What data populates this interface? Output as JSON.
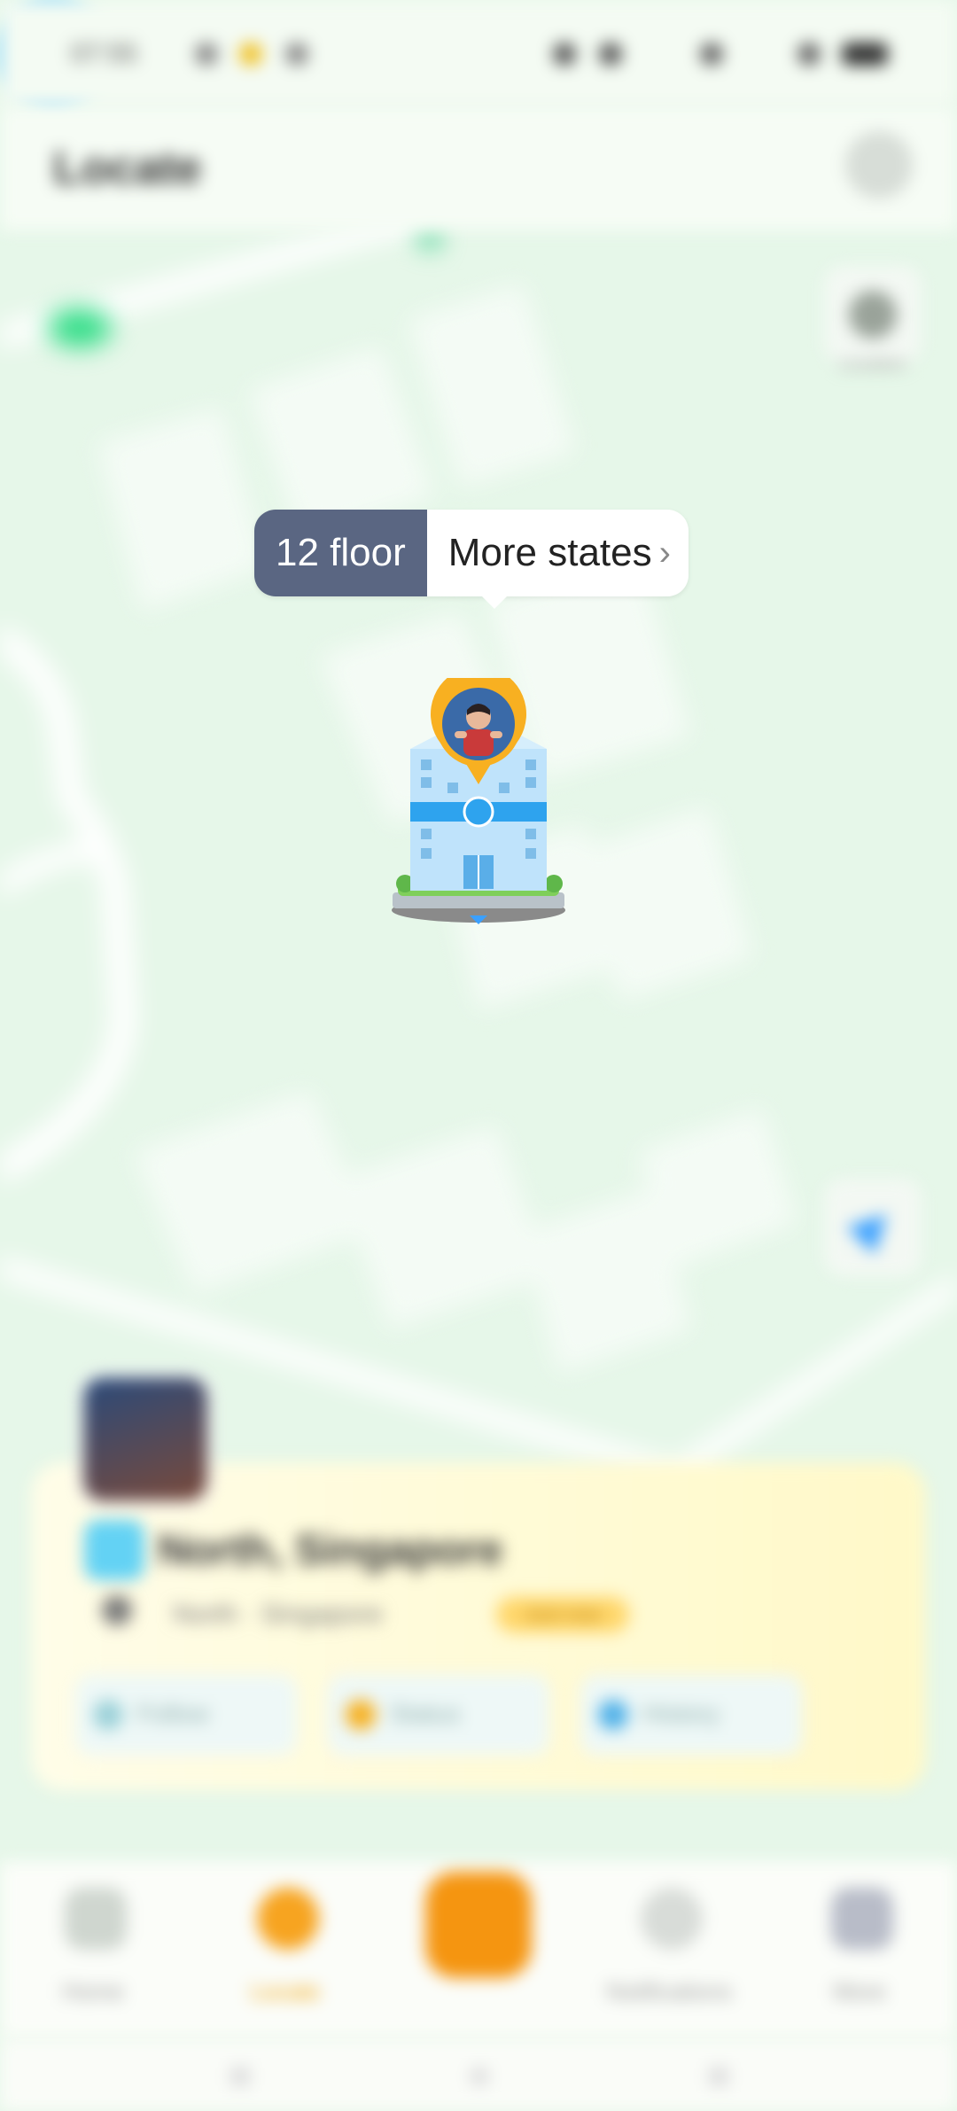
{
  "status_bar": {
    "time": "07:55"
  },
  "header": {
    "title": "Locate"
  },
  "map": {
    "layers_label": "Location",
    "marker": {
      "floor_label": "12 floor",
      "more_label": "More states",
      "chevron": "›"
    }
  },
  "card": {
    "location_title": "North, Singapore",
    "location_sub": "North · Singapore",
    "badge": "Just now",
    "actions": [
      {
        "label": "Follow",
        "icon": "route-icon"
      },
      {
        "label": "Status",
        "icon": "sun-icon"
      },
      {
        "label": "History",
        "icon": "flag-icon"
      }
    ]
  },
  "bottom_nav": {
    "items": [
      {
        "label": "Home",
        "icon": "home-icon"
      },
      {
        "label": "Locate",
        "icon": "locate-icon"
      },
      {
        "label": "",
        "icon": "center-action-icon"
      },
      {
        "label": "Notifications",
        "icon": "bell-icon"
      },
      {
        "label": "More",
        "icon": "grid-icon"
      }
    ]
  },
  "colors": {
    "map_bg": "#e6f7e9",
    "pill_dark": "#5a6682",
    "accent_orange": "#f59510",
    "accent_blue": "#3aa0ff"
  }
}
